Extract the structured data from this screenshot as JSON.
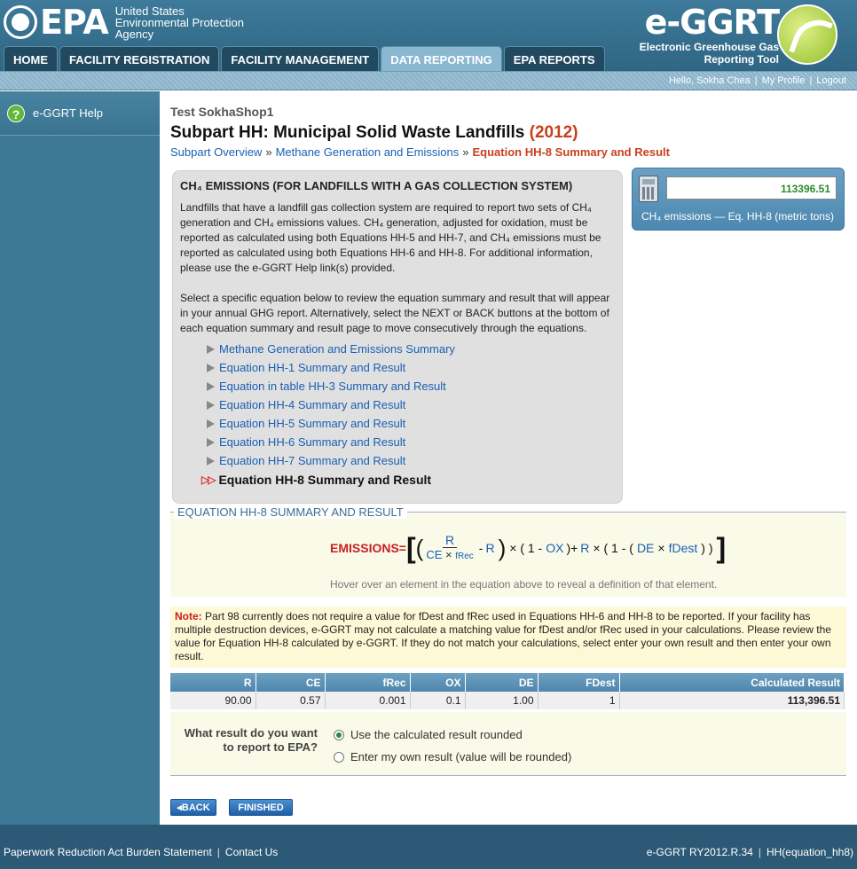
{
  "header": {
    "epa_logo_text": "EPA",
    "agency_line1": "United States",
    "agency_line2": "Environmental Protection",
    "agency_line3": "Agency",
    "ggrt_logo_text": "e-GGRT",
    "ggrt_subtitle1": "Electronic Greenhouse Gas",
    "ggrt_subtitle2": "Reporting Tool"
  },
  "nav": {
    "tabs": [
      {
        "label": "HOME"
      },
      {
        "label": "FACILITY REGISTRATION"
      },
      {
        "label": "FACILITY MANAGEMENT"
      },
      {
        "label": "DATA REPORTING"
      },
      {
        "label": "EPA REPORTS"
      }
    ]
  },
  "userbar": {
    "greeting": "Hello, Sokha Chea",
    "profile": "My Profile",
    "logout": "Logout"
  },
  "sidebar": {
    "help_label": "e-GGRT Help"
  },
  "main": {
    "facility": "Test SokhaShop1",
    "title": "Subpart HH: Municipal Solid Waste Landfills",
    "year": "(2012)",
    "breadcrumb": [
      "Subpart Overview",
      "Methane Generation and Emissions",
      "Equation HH-8 Summary and Result"
    ]
  },
  "info": {
    "heading": "CH₄ EMISSIONS (FOR LANDFILLS WITH A GAS COLLECTION SYSTEM)",
    "para1": "Landfills that have a landfill gas collection system are required to report two sets of CH₄ generation and CH₄ emissions values. CH₄ generation, adjusted for oxidation, must be reported as calculated using both Equations HH-5 and HH-7, and CH₄ emissions must be reported as calculated using both Equations HH-6 and HH-8. For additional information, please use the e-GGRT Help link(s) provided.",
    "para2": "Select a specific equation below to review the equation summary and result that will appear in your annual GHG report. Alternatively, select the NEXT or BACK buttons at the bottom of each equation summary and result page to move consecutively through the equations.",
    "links": [
      "Methane Generation and Emissions Summary",
      "Equation HH-1 Summary and Result",
      "Equation in table HH-3 Summary and Result",
      "Equation HH-4 Summary and Result",
      "Equation HH-5 Summary and Result",
      "Equation HH-6 Summary and Result",
      "Equation HH-7 Summary and Result"
    ],
    "current": "Equation HH-8 Summary and Result"
  },
  "result_box": {
    "value": "113396.51",
    "label": "CH₄ emissions — Eq. HH-8 (metric tons)"
  },
  "equation": {
    "section_title": "EQUATION HH-8 SUMMARY AND RESULT",
    "lhs": "EMISSIONS",
    "R": "R",
    "CE": "CE",
    "fRec": "fRec",
    "OX": "OX",
    "DE": "DE",
    "fDest": "fDest",
    "hint": "Hover over an element in the equation above to reveal a definition of that element."
  },
  "note": {
    "label": "Note:",
    "text": "Part 98 currently does not require a value for fDest and fRec used in Equations HH-6 and HH-8 to be reported. If your facility has multiple destruction devices, e-GGRT may not calculate a matching value for fDest and/or fRec used in your calculations. Please review the value for Equation HH-8 calculated by e-GGRT. If they do not match your calculations, select enter your own result and then enter your own result."
  },
  "table": {
    "headers": [
      "R",
      "CE",
      "fRec",
      "OX",
      "DE",
      "FDest",
      "Calculated Result"
    ],
    "row": [
      "90.00",
      "0.57",
      "0.001",
      "0.1",
      "1.00",
      "1",
      "113,396.51"
    ]
  },
  "options": {
    "question_line1": "What result do you want",
    "question_line2": "to report to EPA?",
    "option1": "Use the calculated result rounded",
    "option2": "Enter my own result (value will be rounded)"
  },
  "buttons": {
    "back": "BACK",
    "finished": "FINISHED"
  },
  "footer": {
    "paperwork": "Paperwork Reduction Act Burden Statement",
    "contact": "Contact Us",
    "version": "e-GGRT RY2012.R.34",
    "page_id": "HH(equation_hh8)"
  }
}
